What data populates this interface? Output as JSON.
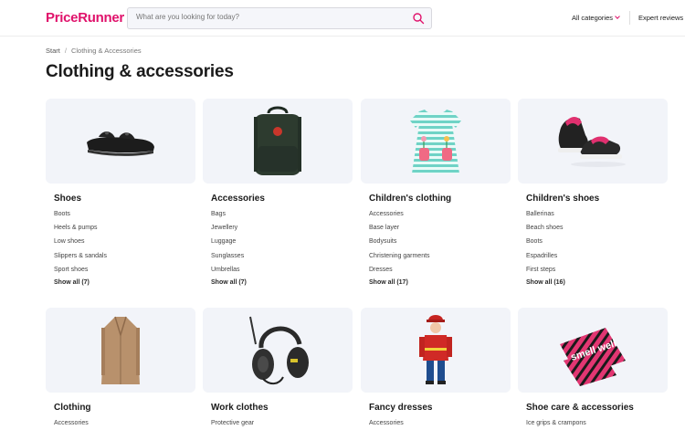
{
  "header": {
    "logo": "PriceRunner",
    "search_placeholder": "What are you looking for today?",
    "all_categories": "All categories",
    "expert_reviews": "Expert reviews"
  },
  "breadcrumb": {
    "start": "Start",
    "current": "Clothing & Accessories"
  },
  "page_title": "Clothing & accessories",
  "categories": [
    {
      "title": "Shoes",
      "image_icon": "sandal-icon",
      "items": [
        "Boots",
        "Heels & pumps",
        "Low shoes",
        "Slippers & sandals",
        "Sport shoes"
      ],
      "show_all": "Show all (7)"
    },
    {
      "title": "Accessories",
      "image_icon": "backpack-icon",
      "items": [
        "Bags",
        "Jewellery",
        "Luggage",
        "Sunglasses",
        "Umbrellas"
      ],
      "show_all": "Show all (7)"
    },
    {
      "title": "Children's clothing",
      "image_icon": "dress-icon",
      "items": [
        "Accessories",
        "Base layer",
        "Bodysuits",
        "Christening garments",
        "Dresses"
      ],
      "show_all": "Show all (17)"
    },
    {
      "title": "Children's shoes",
      "image_icon": "kids-sneakers-icon",
      "items": [
        "Ballerinas",
        "Beach shoes",
        "Boots",
        "Espadrilles",
        "First steps"
      ],
      "show_all": "Show all (16)"
    },
    {
      "title": "Clothing",
      "image_icon": "coat-icon",
      "items": [
        "Accessories"
      ]
    },
    {
      "title": "Work clothes",
      "image_icon": "ear-defenders-icon",
      "items": [
        "Protective gear"
      ]
    },
    {
      "title": "Fancy dresses",
      "image_icon": "costume-icon",
      "items": [
        "Accessories"
      ]
    },
    {
      "title": "Shoe care & accessories",
      "image_icon": "smellwell-icon",
      "image_text": "smell well",
      "items": [
        "Ice grips & crampons"
      ]
    }
  ],
  "colors": {
    "brand": "#e0126b",
    "card_bg": "#f2f4f9"
  }
}
